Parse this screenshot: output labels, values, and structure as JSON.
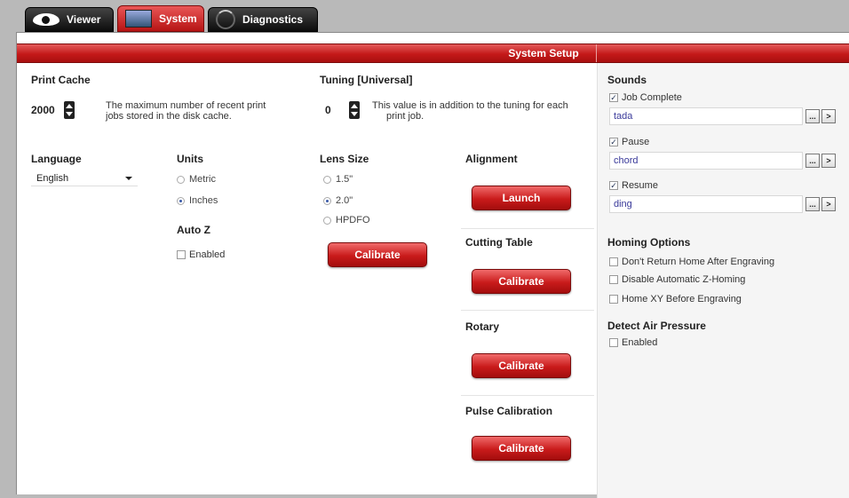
{
  "tabs": [
    {
      "label": "Viewer",
      "icon": "eye-icon"
    },
    {
      "label": "System",
      "icon": "monitor-icon"
    },
    {
      "label": "Diagnostics",
      "icon": "swirl-icon"
    }
  ],
  "header": {
    "title": "System Setup"
  },
  "print_cache": {
    "heading": "Print Cache",
    "value": "2000",
    "desc_line1": "The maximum number of recent print",
    "desc_line2": "jobs stored in the disk cache."
  },
  "tuning": {
    "heading": "Tuning [Universal]",
    "value": "0",
    "desc_line1": "This value is in addition to the tuning for each",
    "desc_line2": "print job."
  },
  "language": {
    "heading": "Language",
    "selected": "English"
  },
  "units": {
    "heading": "Units",
    "options": [
      {
        "label": "Metric",
        "selected": false
      },
      {
        "label": "Inches",
        "selected": true
      }
    ]
  },
  "auto_z": {
    "heading": "Auto Z",
    "enabled_label": "Enabled",
    "enabled": false
  },
  "lens_size": {
    "heading": "Lens Size",
    "options": [
      {
        "label": "1.5\"",
        "selected": false
      },
      {
        "label": "2.0\"",
        "selected": true
      },
      {
        "label": "HPDFO",
        "selected": false
      }
    ],
    "button": "Calibrate"
  },
  "alignment": {
    "heading": "Alignment",
    "button": "Launch"
  },
  "cutting_table": {
    "heading": "Cutting Table",
    "button": "Calibrate"
  },
  "rotary": {
    "heading": "Rotary",
    "button": "Calibrate"
  },
  "pulse_calibration": {
    "heading": "Pulse Calibration",
    "button": "Calibrate"
  },
  "sounds": {
    "heading": "Sounds",
    "items": [
      {
        "label": "Job Complete",
        "checked": true,
        "value": "tada"
      },
      {
        "label": "Pause",
        "checked": true,
        "value": "chord"
      },
      {
        "label": "Resume",
        "checked": true,
        "value": "ding"
      }
    ],
    "browse_label": "...",
    "play_label": ">"
  },
  "homing_options": {
    "heading": "Homing Options",
    "items": [
      {
        "label": "Don't Return Home After Engraving",
        "checked": false
      },
      {
        "label": "Disable Automatic Z-Homing",
        "checked": false
      },
      {
        "label": "Home XY Before Engraving",
        "checked": false
      }
    ]
  },
  "detect_air_pressure": {
    "heading": "Detect Air Pressure",
    "enabled_label": "Enabled",
    "enabled": false
  },
  "colors": {
    "accent": "#c41919",
    "panel": "#ffffff",
    "background": "#b9b9b9"
  }
}
